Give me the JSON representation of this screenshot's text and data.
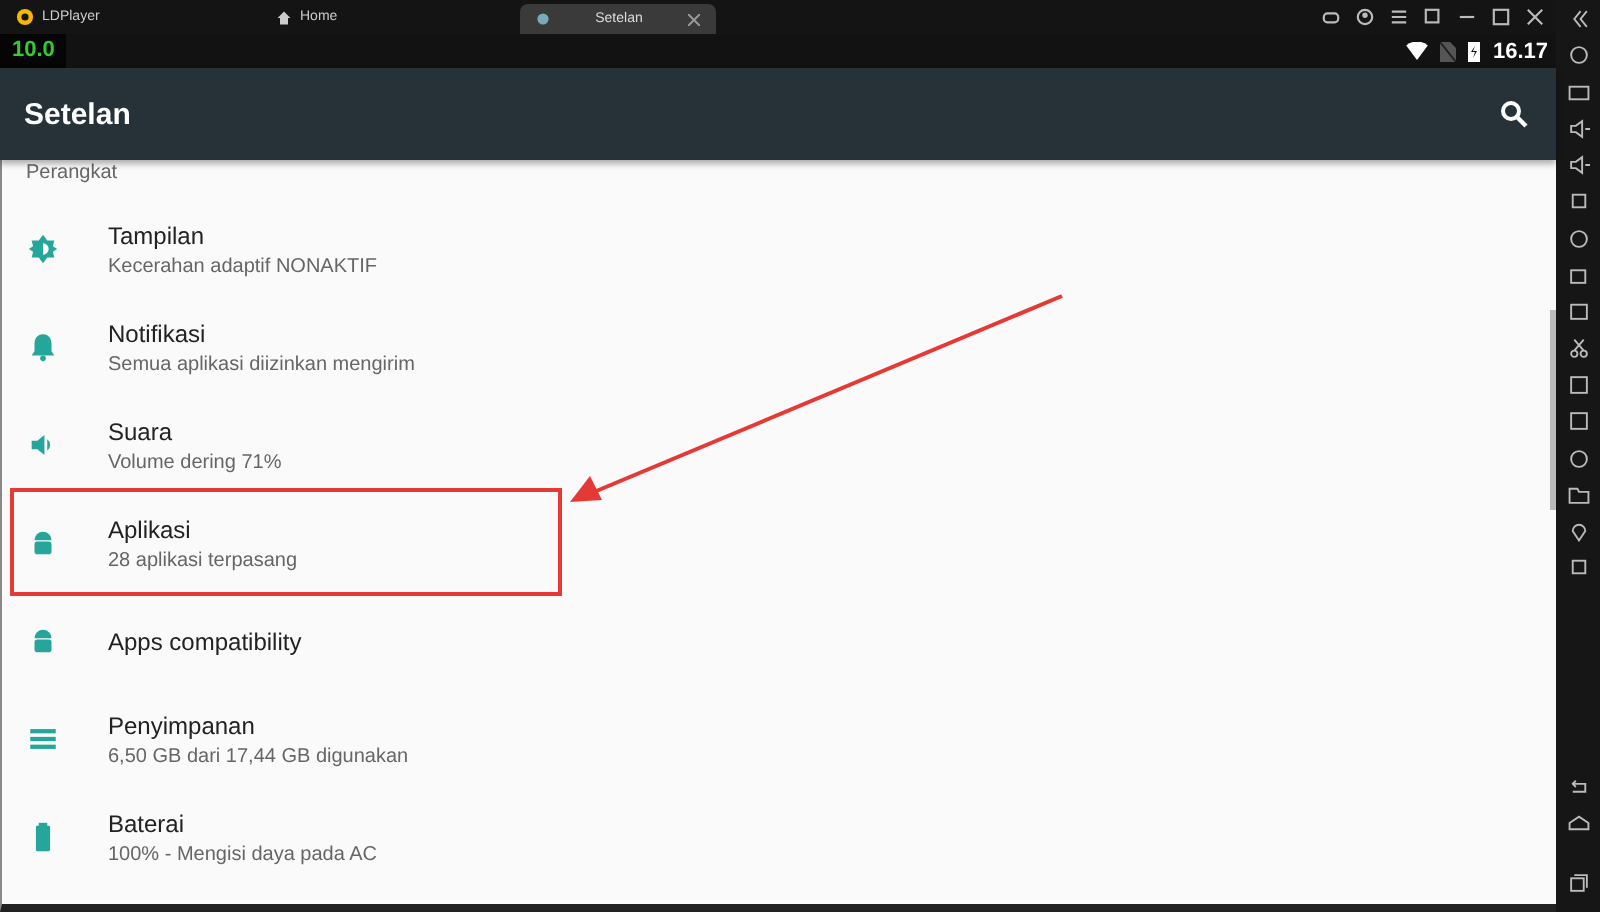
{
  "browser_tabs": [
    {
      "label": "LDPlayer",
      "selected": false
    },
    {
      "label": "Home",
      "selected": false
    },
    {
      "label": "Setelan",
      "selected": true
    }
  ],
  "status_bar": {
    "fps": "10.0",
    "time": "16.17"
  },
  "toolbar": {
    "title": "Setelan"
  },
  "section": "Perangkat",
  "items": [
    {
      "title": "Tampilan",
      "subtitle": "Kecerahan adaptif NONAKTIF",
      "highlighted": false
    },
    {
      "title": "Notifikasi",
      "subtitle": "Semua aplikasi diizinkan mengirim",
      "highlighted": false
    },
    {
      "title": "Suara",
      "subtitle": "Volume dering 71%",
      "highlighted": false
    },
    {
      "title": "Aplikasi",
      "subtitle": "28 aplikasi terpasang",
      "highlighted": true
    },
    {
      "title": "Apps compatibility",
      "highlighted": false
    },
    {
      "title": "Penyimpanan",
      "subtitle": "6,50 GB dari 17,44 GB digunakan",
      "highlighted": false
    },
    {
      "title": "Baterai",
      "subtitle": "100% - Mengisi daya pada AC",
      "highlighted": false
    }
  ]
}
